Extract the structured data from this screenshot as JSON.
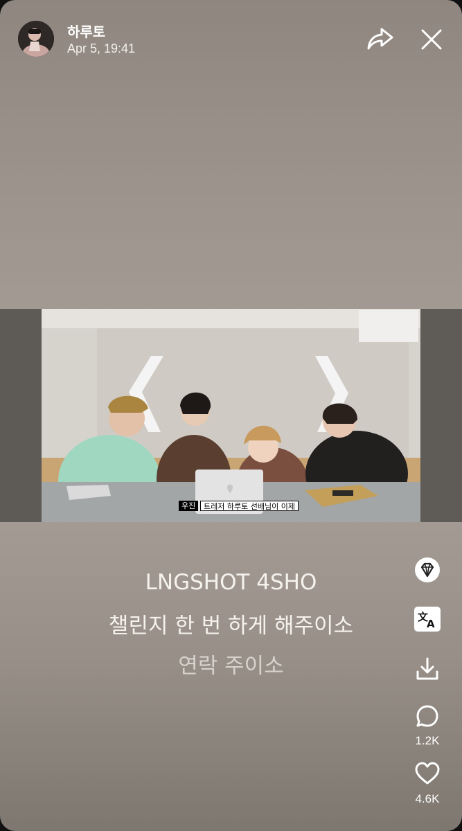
{
  "header": {
    "username": "하루토",
    "timestamp": "Apr 5, 19:41"
  },
  "video": {
    "subtitle_speaker": "우진",
    "subtitle_text": "트레저 하루토 선배님이 이제"
  },
  "caption": {
    "line1": "LNGSHOT 4SHO",
    "line2": "챌린지 한 번 하게 해주이소",
    "line3": "연락 주이소"
  },
  "actions": {
    "comments_count": "1.2K",
    "likes_count": "4.6K"
  },
  "icons": {
    "share": "share-arrow-icon",
    "close": "close-icon",
    "gem": "diamond-icon",
    "translate": "translate-icon",
    "download": "download-icon",
    "comment": "comment-icon",
    "like": "heart-icon"
  },
  "colors": {
    "overlay_text": "#ffffff",
    "background": "#a39b93"
  }
}
